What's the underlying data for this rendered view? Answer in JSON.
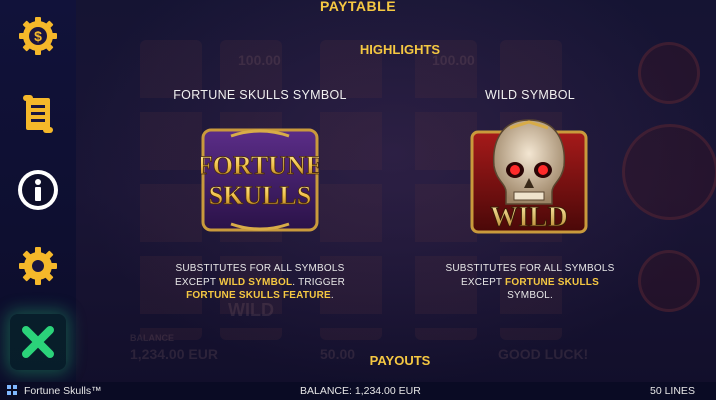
{
  "header": {
    "title": "PAYTABLE"
  },
  "sections": {
    "highlights": "HIGHLIGHTS",
    "payouts": "PAYOUTS"
  },
  "menu": [
    {
      "name": "coin-settings-icon",
      "label": ""
    },
    {
      "name": "scroll-paytable-icon",
      "label": ""
    },
    {
      "name": "info-icon",
      "label": ""
    },
    {
      "name": "settings-gear-icon",
      "label": ""
    },
    {
      "name": "close-icon",
      "label": ""
    }
  ],
  "symbols": [
    {
      "title": "FORTUNE SKULLS SYMBOL",
      "logo_line1": "FORTUNE",
      "logo_line2": "SKULLS",
      "desc": [
        {
          "t": "SUBSTITUTES FOR ALL SYMBOLS",
          "hl": false
        },
        {
          "t": "EXCEPT ",
          "hl": false,
          "inline": true,
          "next": "WILD SYMBOL",
          "after": ". TRIGGER"
        },
        {
          "t": "FORTUNE SKULLS FEATURE",
          "hl": true,
          "after": "."
        }
      ]
    },
    {
      "title": "WILD SYMBOL",
      "logo_line1": "WILD",
      "desc_lines": [
        "SUBSTITUTES FOR ALL SYMBOLS",
        "EXCEPT ",
        "FORTUNE SKULLS",
        "SYMBOL."
      ]
    }
  ],
  "fortune_desc": {
    "line1": "SUBSTITUTES FOR ALL SYMBOLS",
    "line2_a": "EXCEPT ",
    "line2_hl": "WILD SYMBOL",
    "line2_b": ". TRIGGER",
    "line3_hl": "FORTUNE SKULLS FEATURE",
    "line3_b": "."
  },
  "wild_desc": {
    "line1": "SUBSTITUTES FOR ALL SYMBOLS",
    "line2_a": "EXCEPT ",
    "line2_hl": "FORTUNE SKULLS",
    "line3": "SYMBOL."
  },
  "background_ghost": {
    "amount1": "100.00",
    "amount2": "100.00",
    "balance_label": "BALANCE",
    "balance_value": "1,234.00 EUR",
    "bet_value": "50.00",
    "message": "GOOD LUCK!",
    "wild_text": "WILD"
  },
  "bottom": {
    "game_name": "Fortune Skulls™",
    "balance": "BALANCE: 1,234.00 EUR",
    "lines": "50 LINES"
  },
  "colors": {
    "accent": "#f5c842",
    "close": "#2bd37a",
    "bg": "#0e0f2a"
  }
}
